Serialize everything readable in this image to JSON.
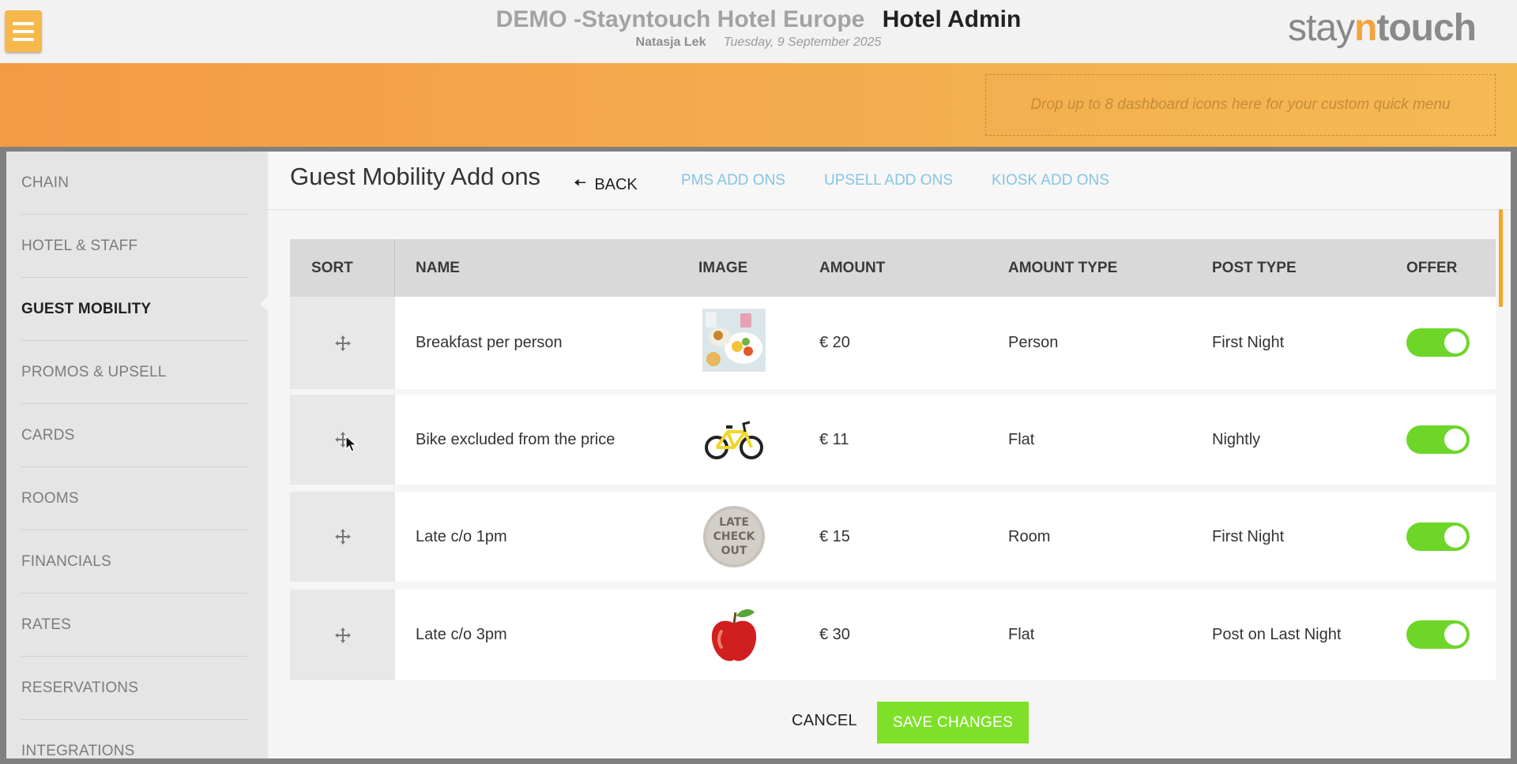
{
  "header": {
    "hotel_name": "DEMO -Stayntouch Hotel Europe",
    "app_name": "Hotel Admin",
    "user_name": "Natasja Lek",
    "date": "Tuesday, 9 September 2025",
    "logo": {
      "part1": "stay",
      "part2": "n",
      "part3": "touch"
    },
    "menu_icon": "hamburger-icon"
  },
  "quick_menu": {
    "placeholder": "Drop up to 8 dashboard icons here for your custom quick menu"
  },
  "sidebar": {
    "items": [
      {
        "label": "CHAIN",
        "active": false
      },
      {
        "label": "HOTEL & STAFF",
        "active": false
      },
      {
        "label": "GUEST MOBILITY",
        "active": true
      },
      {
        "label": "PROMOS & UPSELL",
        "active": false
      },
      {
        "label": "CARDS",
        "active": false
      },
      {
        "label": "ROOMS",
        "active": false
      },
      {
        "label": "FINANCIALS",
        "active": false
      },
      {
        "label": "RATES",
        "active": false
      },
      {
        "label": "RESERVATIONS",
        "active": false
      },
      {
        "label": "INTEGRATIONS",
        "active": false
      }
    ]
  },
  "page": {
    "title": "Guest Mobility Add ons",
    "back_label": "BACK",
    "tabs": [
      {
        "label": "PMS ADD ONS"
      },
      {
        "label": "UPSELL ADD ONS"
      },
      {
        "label": "KIOSK ADD ONS"
      }
    ]
  },
  "table": {
    "headers": {
      "sort": "SORT",
      "name": "NAME",
      "image": "IMAGE",
      "amount": "AMOUNT",
      "amount_type": "AMOUNT TYPE",
      "post_type": "POST TYPE",
      "offer": "OFFER"
    },
    "rows": [
      {
        "name": "Breakfast per person",
        "image": "breakfast-image",
        "amount": "€ 20",
        "amount_type": "Person",
        "post_type": "First Night",
        "offer": true
      },
      {
        "name": "Bike excluded from the price",
        "image": "bicycle-image",
        "amount": "€ 11",
        "amount_type": "Flat",
        "post_type": "Nightly",
        "offer": true
      },
      {
        "name": "Late c/o 1pm",
        "image": "late-checkout-image",
        "late_checkout_text": [
          "LATE",
          "CHECK",
          "OUT"
        ],
        "amount": "€ 15",
        "amount_type": "Room",
        "post_type": "First Night",
        "offer": true
      },
      {
        "name": "Late c/o 3pm",
        "image": "apple-image",
        "amount": "€ 30",
        "amount_type": "Flat",
        "post_type": "Post on Last Night",
        "offer": true
      }
    ]
  },
  "footer": {
    "cancel_label": "CANCEL",
    "save_label": "SAVE CHANGES"
  },
  "colors": {
    "accent_orange": "#f5a33c",
    "toggle_on": "#6dd629",
    "save_green": "#7fe02a",
    "tab_link": "#86c4e6"
  }
}
